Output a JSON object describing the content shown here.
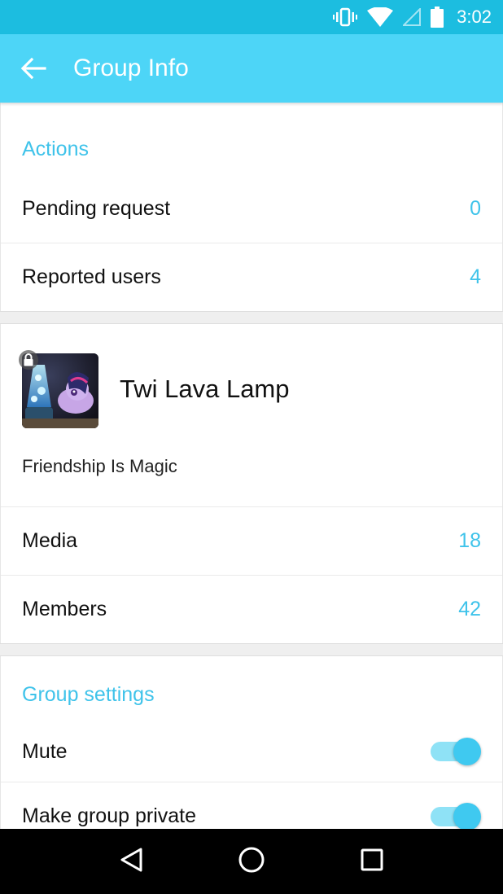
{
  "status_bar": {
    "time": "3:02",
    "icons": [
      "vibrate-icon",
      "wifi-icon",
      "signal-icon",
      "battery-icon"
    ]
  },
  "app_bar": {
    "title": "Group Info",
    "back_icon": "arrow-left-icon"
  },
  "actions": {
    "header": "Actions",
    "items": [
      {
        "label": "Pending request",
        "value": "0"
      },
      {
        "label": "Reported users",
        "value": "4"
      }
    ]
  },
  "group": {
    "name": "Twi Lava Lamp",
    "description": "Friendship Is Magic",
    "lock_icon": "lock-icon",
    "stats": [
      {
        "label": "Media",
        "value": "18"
      },
      {
        "label": "Members",
        "value": "42"
      }
    ]
  },
  "settings": {
    "header": "Group settings",
    "items": [
      {
        "label": "Mute",
        "on": true
      },
      {
        "label": "Make group private",
        "on": true
      }
    ]
  },
  "nav_bar": {
    "icons": [
      "back-triangle-icon",
      "home-circle-icon",
      "recents-square-icon"
    ]
  },
  "colors": {
    "accent": "#3fc3ea",
    "app_bar": "#4dd5f7",
    "status_bar": "#1cbde0"
  }
}
